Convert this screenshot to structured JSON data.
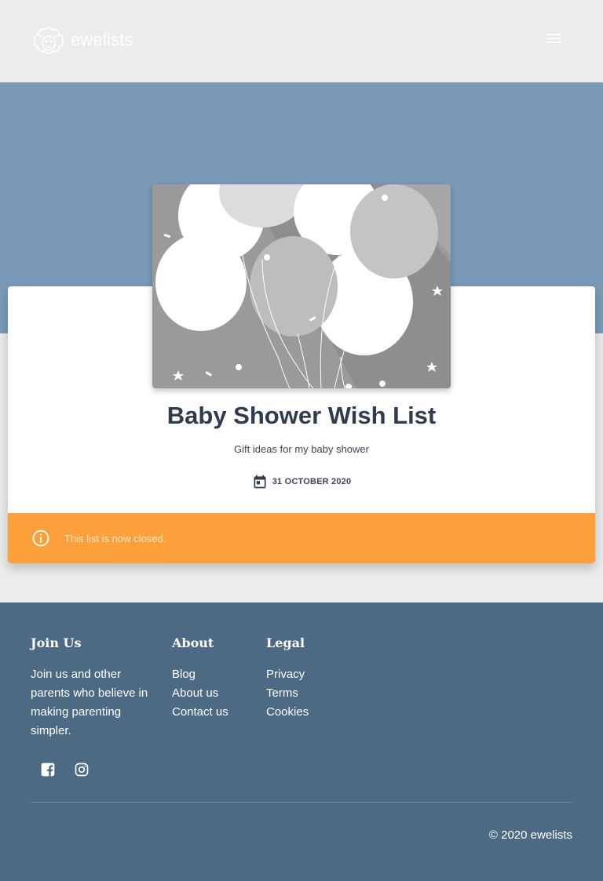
{
  "header": {
    "logo_text": "ewelists",
    "menu_icon": "hamburger-menu-icon"
  },
  "list": {
    "title": "Baby Shower Wish List",
    "description": "Gift ideas for my baby shower",
    "date": "31 OCTOBER 2020",
    "date_icon": "calendar-icon",
    "image": "balloons-illustration"
  },
  "notice": {
    "text": "This list is now closed.",
    "icon": "info-icon",
    "color": "#fba03a"
  },
  "footer": {
    "join": {
      "heading": "Join Us",
      "text": "Join us and other parents who believe in making parenting simpler."
    },
    "about": {
      "heading": "About",
      "links": [
        "Blog",
        "About us",
        "Contact us"
      ]
    },
    "legal": {
      "heading": "Legal",
      "links": [
        "Privacy",
        "Terms",
        "Cookies"
      ]
    },
    "socials": [
      "facebook-icon",
      "instagram-icon"
    ],
    "copyright": "© 2020 ewelists"
  },
  "colors": {
    "hero": "#7b9ab8",
    "footer": "#4d6a85",
    "title": "#2e3c4d"
  }
}
